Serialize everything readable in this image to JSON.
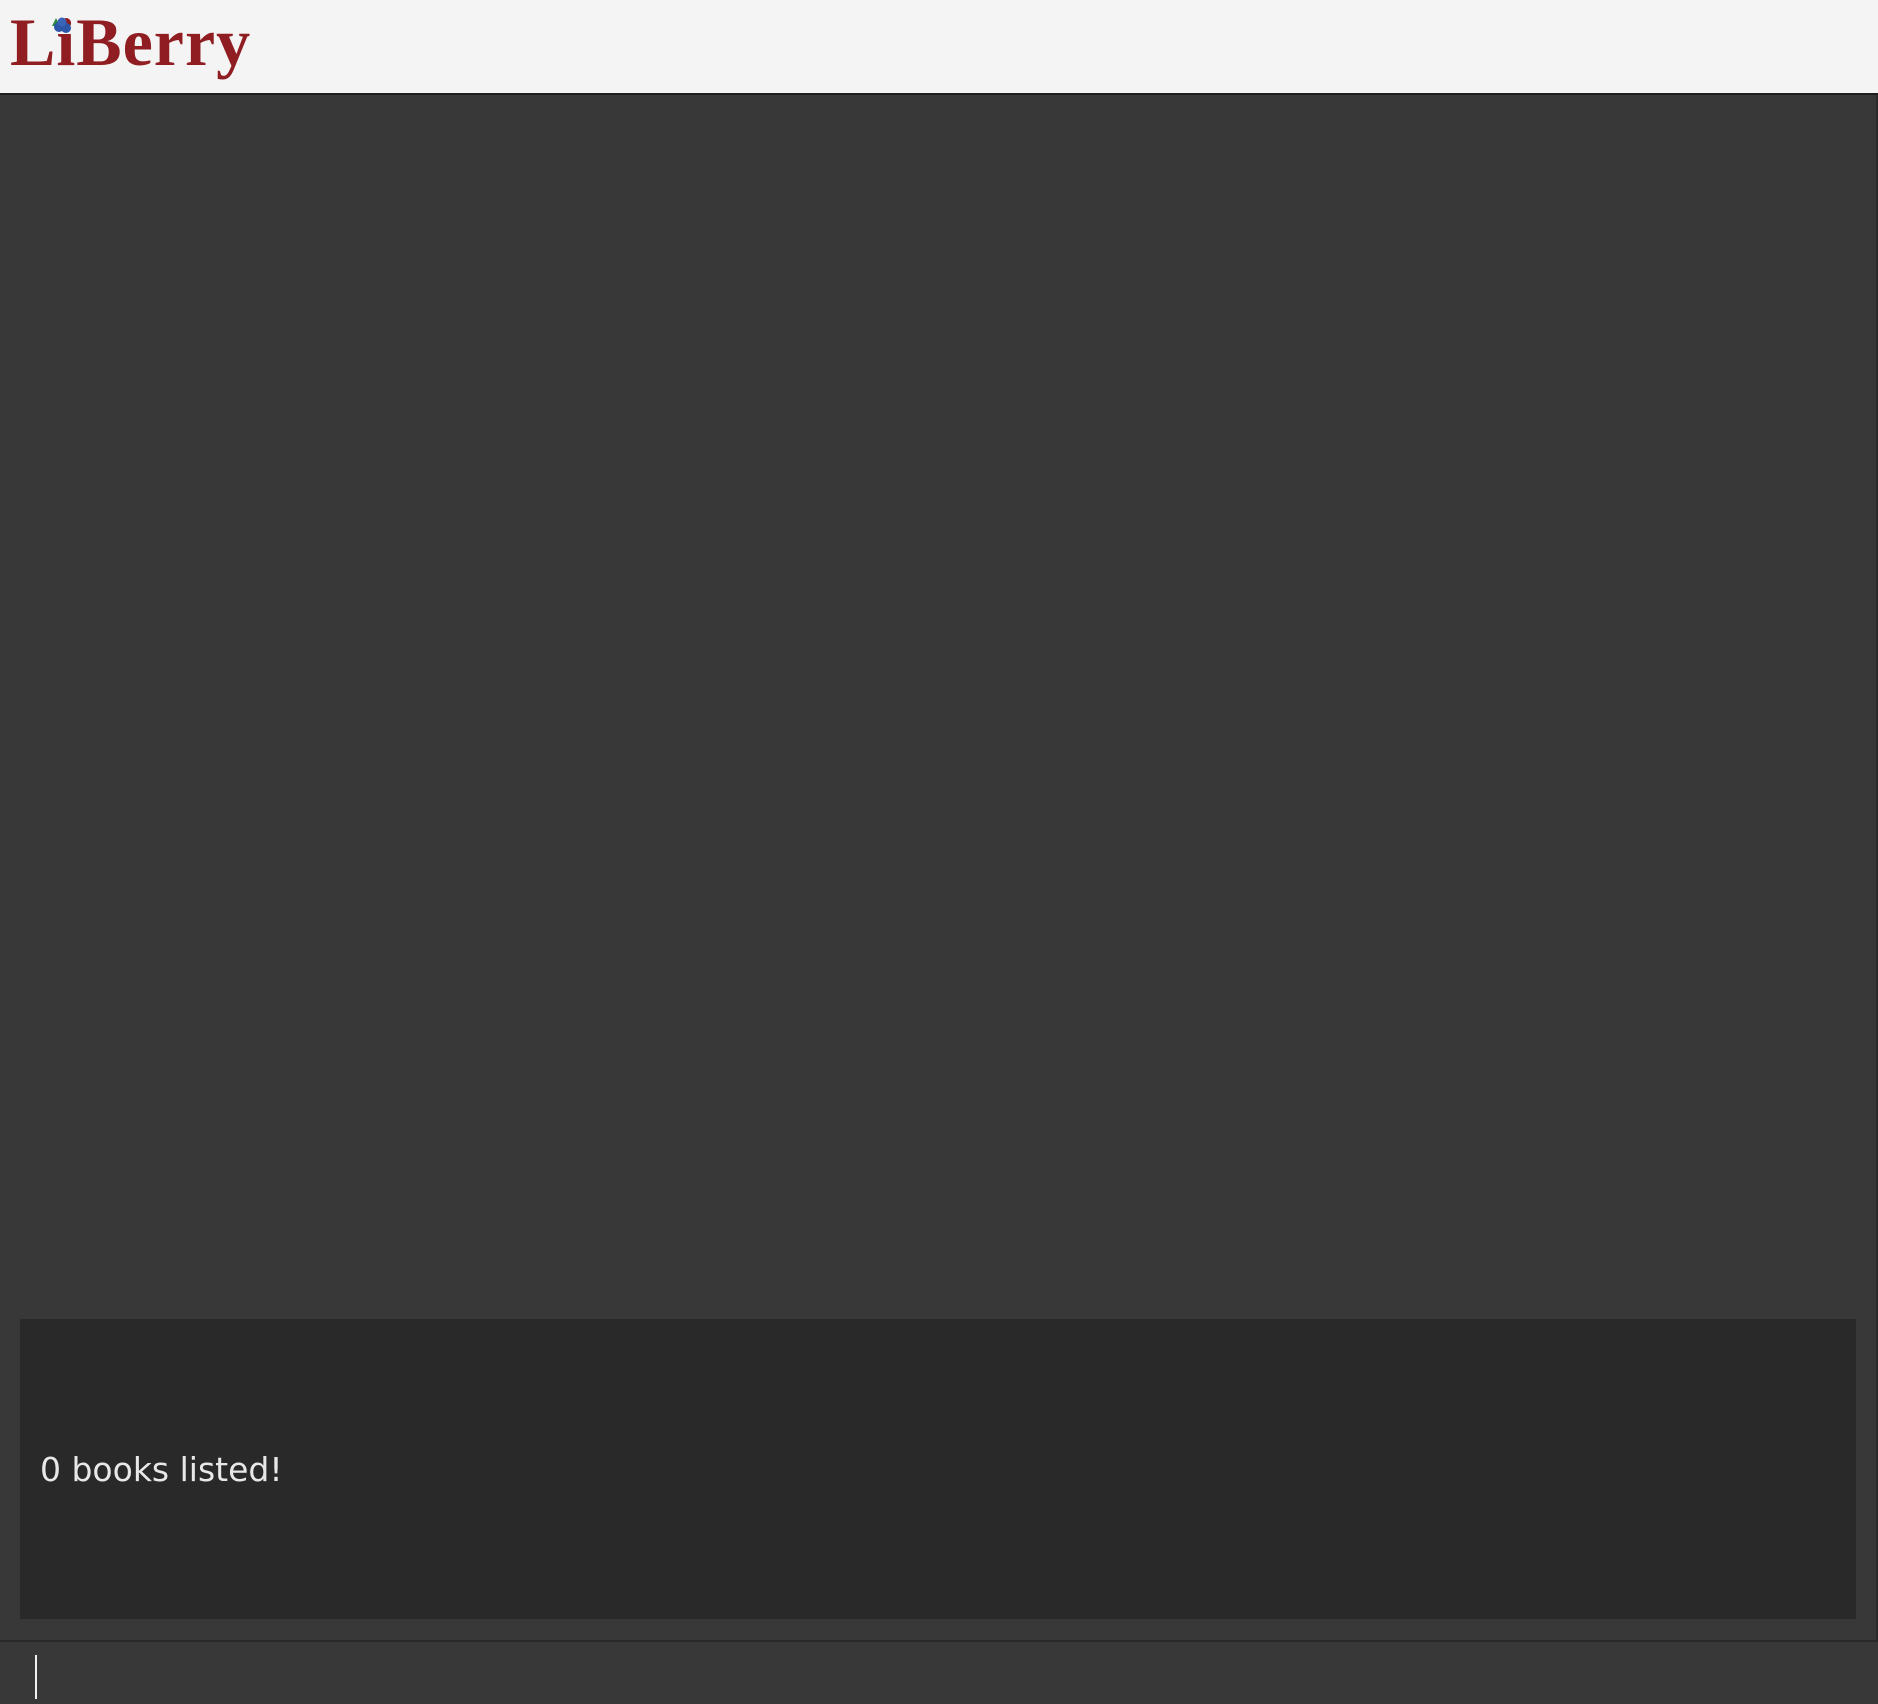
{
  "app": {
    "logo_text": "LiBerry",
    "brand_color": "#8f1d21"
  },
  "icons": {
    "logo_berry": "berry-icon"
  },
  "result": {
    "message": "0 books listed!"
  },
  "command": {
    "value": "",
    "placeholder": ""
  }
}
